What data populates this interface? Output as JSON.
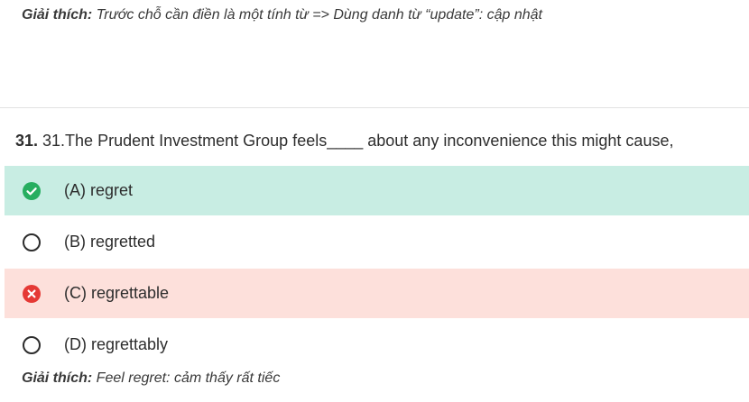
{
  "top_explanation": {
    "label": "Giải thích:",
    "text": " Trước chỗ cần điền là một tính từ => Dùng danh từ “update”: cập nhật"
  },
  "question": {
    "number": "31.",
    "text": " 31.The Prudent Investment Group feels____ about any inconvenience this might cause,"
  },
  "options": [
    {
      "label": "(A) regret",
      "state": "correct",
      "icon": "check-circle-icon",
      "color": "#c8ede3"
    },
    {
      "label": "(B) regretted",
      "state": "unselected",
      "icon": "radio-empty-icon"
    },
    {
      "label": "(C) regrettable",
      "state": "wrong",
      "icon": "x-circle-icon",
      "color": "#fde0db"
    },
    {
      "label": "(D) regrettably",
      "state": "unselected",
      "icon": "radio-empty-icon"
    }
  ],
  "bottom_explanation": {
    "label": "Giải thích:",
    "text": " Feel regret: cảm thấy rất tiếc"
  },
  "colors": {
    "correct_icon": "#27ae60",
    "wrong_icon": "#e53935"
  }
}
